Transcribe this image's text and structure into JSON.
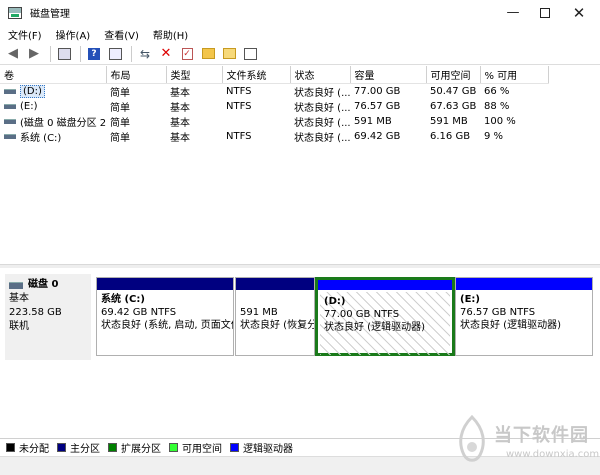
{
  "window": {
    "title": "磁盘管理",
    "min_glyph": "—",
    "close_glyph": "✕"
  },
  "menu": [
    "文件(F)",
    "操作(A)",
    "查看(V)",
    "帮助(H)"
  ],
  "toolbar_icons": [
    "back-arrow-icon",
    "forward-arrow-icon",
    "console-tree-icon",
    "help-icon",
    "properties-icon",
    "connect-icon",
    "delete-icon",
    "check-icon",
    "folder-up-icon",
    "folder-open-icon",
    "disk-list-icon"
  ],
  "table": {
    "columns": [
      "卷",
      "布局",
      "类型",
      "文件系统",
      "状态",
      "容量",
      "可用空间",
      "% 可用"
    ],
    "rows": [
      {
        "vol": "(D:)",
        "layout": "简单",
        "type": "基本",
        "fs": "NTFS",
        "status": "状态良好 (...",
        "cap": "77.00 GB",
        "free": "50.47 GB",
        "pct": "66 %",
        "selected": true
      },
      {
        "vol": "(E:)",
        "layout": "简单",
        "type": "基本",
        "fs": "NTFS",
        "status": "状态良好 (...",
        "cap": "76.57 GB",
        "free": "67.63 GB",
        "pct": "88 %",
        "selected": false
      },
      {
        "vol": "(磁盘 0 磁盘分区 2)",
        "layout": "简单",
        "type": "基本",
        "fs": "",
        "status": "状态良好 (...",
        "cap": "591 MB",
        "free": "591 MB",
        "pct": "100 %",
        "selected": false
      },
      {
        "vol": "系统 (C:)",
        "layout": "简单",
        "type": "基本",
        "fs": "NTFS",
        "status": "状态良好 (...",
        "cap": "69.42 GB",
        "free": "6.16 GB",
        "pct": "9 %",
        "selected": false
      }
    ]
  },
  "disk": {
    "name": "磁盘 0",
    "type": "基本",
    "size": "223.58 GB",
    "state": "联机"
  },
  "partitions": [
    {
      "name": "系统 (C:)",
      "size": "69.42 GB NTFS",
      "status": "状态良好 (系统, 启动, 页面文件"
    },
    {
      "name": "",
      "size": "591 MB",
      "status": "状态良好 (恢复分"
    },
    {
      "name": "(D:)",
      "size": "77.00 GB NTFS",
      "status": "状态良好 (逻辑驱动器)"
    },
    {
      "name": "(E:)",
      "size": "76.57 GB NTFS",
      "status": "状态良好 (逻辑驱动器)"
    }
  ],
  "legend": [
    {
      "label": "未分配",
      "color": "#000000"
    },
    {
      "label": "主分区",
      "color": "#000080"
    },
    {
      "label": "扩展分区",
      "color": "#008000"
    },
    {
      "label": "可用空间",
      "color": "#33ff33"
    },
    {
      "label": "逻辑驱动器",
      "color": "#0000ff"
    }
  ],
  "watermark": {
    "line1": "当下软件园",
    "line2": "www.downxia.com"
  }
}
